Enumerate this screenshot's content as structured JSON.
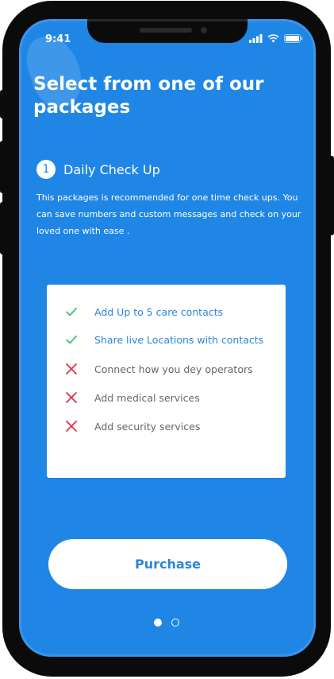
{
  "status_bar": {
    "time": "9:41"
  },
  "page": {
    "title": "Select from one of our packages"
  },
  "package": {
    "number": "1",
    "name": "Daily Check Up",
    "description": "This packages is recommended for one time check ups. You can save numbers and custom messages and check on your loved one with ease ."
  },
  "features": [
    {
      "label": "Add Up to 5 care contacts",
      "included": true,
      "icon": "check-icon"
    },
    {
      "label": "Share live Locations with contacts",
      "included": true,
      "icon": "check-icon"
    },
    {
      "label": "Connect how you dey operators",
      "included": false,
      "icon": "cross-icon"
    },
    {
      "label": "Add medical services",
      "included": false,
      "icon": "cross-icon"
    },
    {
      "label": "Add security services",
      "included": false,
      "icon": "cross-icon"
    }
  ],
  "purchase_button": {
    "label": "Purchase"
  },
  "pagination": {
    "total": 2,
    "current": 1
  },
  "colors": {
    "background": "#1f86e6",
    "included_text": "#2a86d8",
    "excluded_text": "#666666",
    "check": "#3cc47c",
    "cross": "#d8344d"
  }
}
